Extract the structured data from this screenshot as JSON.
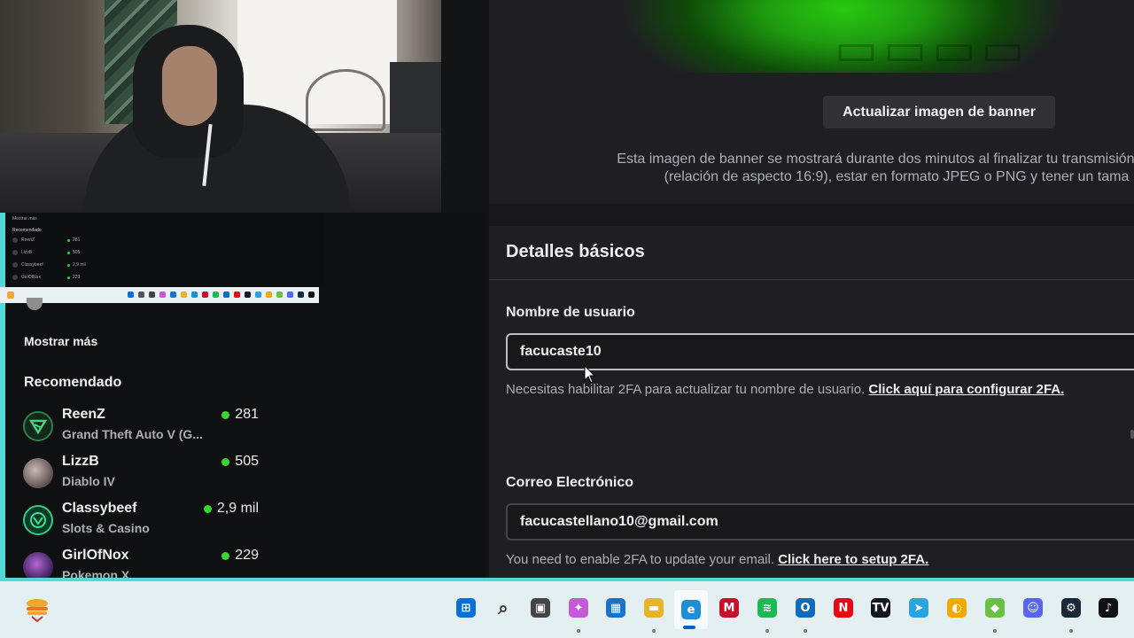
{
  "colors": {
    "accent_cyan": "#53d8d8",
    "live_green": "#38d533",
    "panel_bg": "#1f1f23",
    "page_bg": "#18181b"
  },
  "sidebar": {
    "show_more": "Mostrar más",
    "recommended_title": "Recomendado",
    "channels": [
      {
        "name": "ReenZ",
        "game": "Grand Theft Auto V (G...",
        "viewers": "281",
        "avatar": "reenz-logo"
      },
      {
        "name": "LizzB",
        "game": "Diablo IV",
        "viewers": "505",
        "avatar": "lizzb-photo"
      },
      {
        "name": "Classybeef",
        "game": "Slots & Casino",
        "viewers": "2,9 mil",
        "avatar": "classybeef-logo"
      },
      {
        "name": "GirlOfNox",
        "game": "Pokemon X",
        "viewers": "229",
        "avatar": "girlofnox-photo"
      }
    ]
  },
  "mini_preview": {
    "show_more": "Mostrar más",
    "top_caption": "Mostrar más",
    "recommended": "Recomendado",
    "items": [
      "ReenZ",
      "LizzB",
      "Classybeef",
      "GirlOfNox"
    ],
    "viewers": [
      "281",
      "505",
      "2,9 mil",
      "229"
    ]
  },
  "banner": {
    "update_button": "Actualizar imagen de banner",
    "note_line1": "Esta imagen de banner se mostrará durante dos minutos al finalizar tu transmisión. Debe",
    "note_line2": "(relación de aspecto 16:9), estar en formato JPEG o PNG y tener un tama"
  },
  "details": {
    "heading": "Detalles básicos",
    "username_label": "Nombre de usuario",
    "username_value": "facucaste10",
    "username_hint": "Necesitas habilitar 2FA para actualizar tu nombre de usuario.",
    "username_link": "Click aquí para configurar 2FA.",
    "email_label": "Correo Electrónico",
    "email_value": "facucastellano10@gmail.com",
    "email_hint": "You need to enable 2FA to update your email.",
    "email_link": "Click here to setup 2FA."
  },
  "taskbar": {
    "apps": [
      {
        "name": "windows-start",
        "glyph": "⊞",
        "color": "#0a6fd6"
      },
      {
        "name": "search",
        "glyph": "⌕",
        "color": "#333333"
      },
      {
        "name": "task-view",
        "glyph": "▣",
        "color": "#444444"
      },
      {
        "name": "copilot",
        "glyph": "✦",
        "color": "#c45ad8"
      },
      {
        "name": "microsoft-store",
        "glyph": "▦",
        "color": "#1a73c9"
      },
      {
        "name": "file-explorer",
        "glyph": "▬",
        "color": "#e8b32a"
      },
      {
        "name": "edge",
        "glyph": "e",
        "color": "#1c8fd6"
      },
      {
        "name": "mcafee",
        "glyph": "M",
        "color": "#c8102e"
      },
      {
        "name": "spotify",
        "glyph": "≋",
        "color": "#1db954"
      },
      {
        "name": "outlook",
        "glyph": "O",
        "color": "#0f6cbd"
      },
      {
        "name": "netflix",
        "glyph": "N",
        "color": "#e50914"
      },
      {
        "name": "tradingview",
        "glyph": "TV",
        "color": "#131722"
      },
      {
        "name": "telegram",
        "glyph": "➤",
        "color": "#2aa3de"
      },
      {
        "name": "chrome-canary",
        "glyph": "◐",
        "color": "#f2a900"
      },
      {
        "name": "bluestacks",
        "glyph": "◆",
        "color": "#6ac045"
      },
      {
        "name": "discord",
        "glyph": "☺",
        "color": "#5865f2"
      },
      {
        "name": "steam",
        "glyph": "⚙",
        "color": "#1b2838"
      },
      {
        "name": "tiktok",
        "glyph": "♪",
        "color": "#111111"
      }
    ]
  }
}
